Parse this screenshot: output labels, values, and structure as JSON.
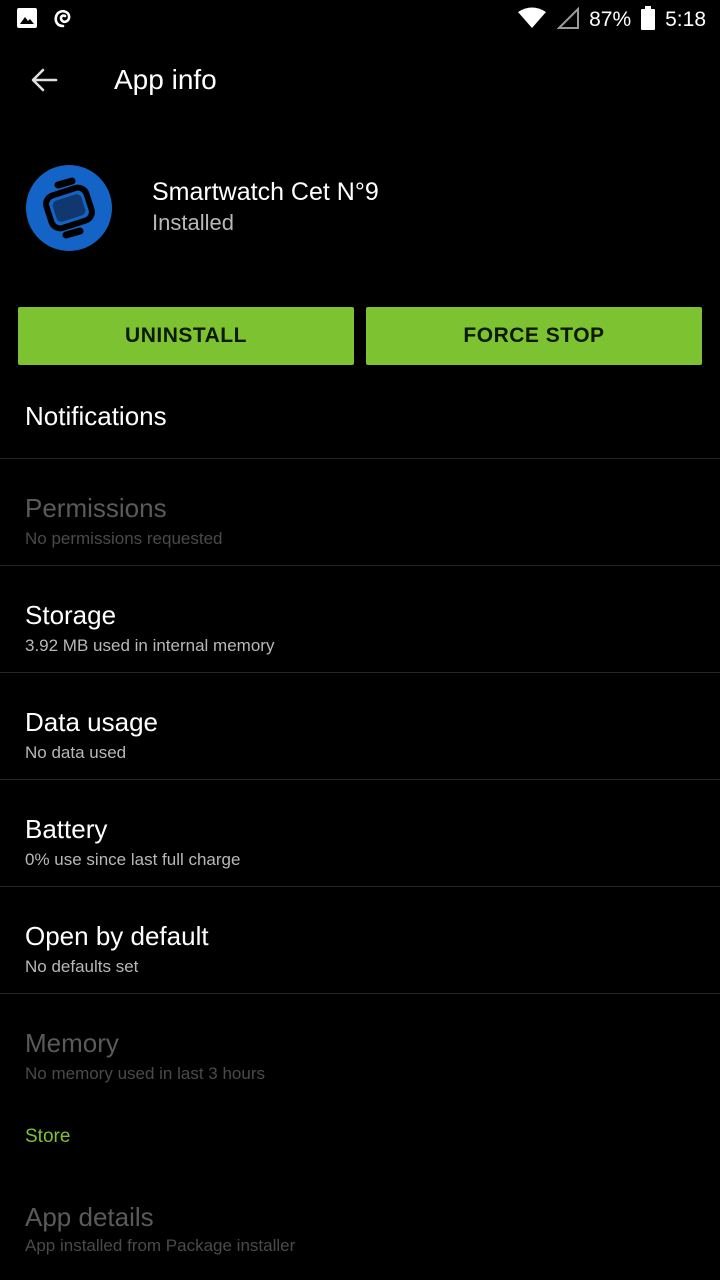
{
  "status_bar": {
    "battery": "87%",
    "time": "5:18",
    "icons": [
      "image-icon",
      "sync-spiral-icon",
      "wifi-icon",
      "signal-icon",
      "battery-icon"
    ]
  },
  "app_bar": {
    "title": "App info",
    "back_icon": "arrow-back-icon"
  },
  "app": {
    "name": "Smartwatch Cet N°9",
    "status": "Installed",
    "icon": "smartwatch-icon",
    "icon_color": "#1464c8"
  },
  "buttons": {
    "uninstall": "UNINSTALL",
    "force_stop": "FORCE STOP",
    "color": "#7dc331"
  },
  "items": [
    {
      "title": "Notifications",
      "subtitle": "",
      "enabled": true
    },
    {
      "title": "Permissions",
      "subtitle": "No permissions requested",
      "enabled": false
    },
    {
      "title": "Storage",
      "subtitle": "3.92 MB used in internal memory",
      "enabled": true
    },
    {
      "title": "Data usage",
      "subtitle": "No data used",
      "enabled": true
    },
    {
      "title": "Battery",
      "subtitle": "0% use since last full charge",
      "enabled": true
    },
    {
      "title": "Open by default",
      "subtitle": "No defaults set",
      "enabled": true
    },
    {
      "title": "Memory",
      "subtitle": "No memory used in last 3 hours",
      "enabled": false
    }
  ],
  "store": {
    "header": "Store",
    "item_title": "App details",
    "item_subtitle": "App installed from Package installer"
  }
}
